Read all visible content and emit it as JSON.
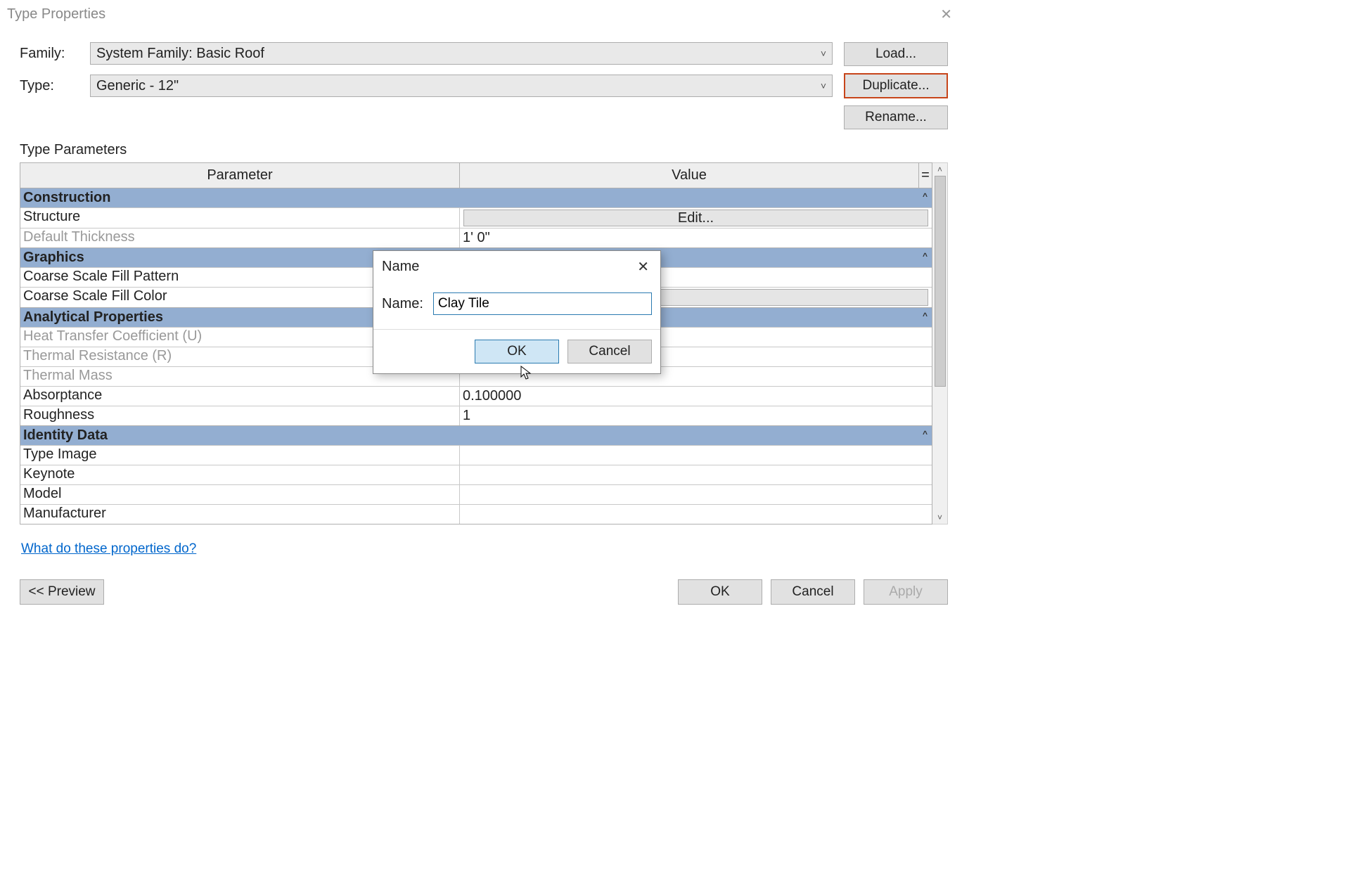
{
  "window": {
    "title": "Type Properties"
  },
  "labels": {
    "family": "Family:",
    "type": "Type:",
    "typeParams": "Type Parameters",
    "paramCol": "Parameter",
    "valueCol": "Value",
    "eqCol": "=",
    "helpLink": "What do these properties do?"
  },
  "selectors": {
    "family": "System Family: Basic Roof",
    "type": "Generic - 12\""
  },
  "buttons": {
    "load": "Load...",
    "duplicate": "Duplicate...",
    "rename": "Rename...",
    "preview": "<<  Preview",
    "ok": "OK",
    "cancel": "Cancel",
    "apply": "Apply",
    "edit": "Edit..."
  },
  "groups": [
    {
      "name": "Construction",
      "rows": [
        {
          "param": "Structure",
          "value_type": "edit"
        },
        {
          "param": "Default Thickness",
          "value": "1'  0\"",
          "dim": true
        }
      ]
    },
    {
      "name": "Graphics",
      "rows": [
        {
          "param": "Coarse Scale Fill Pattern",
          "value": ""
        },
        {
          "param": "Coarse Scale Fill Color",
          "value_type": "color"
        }
      ]
    },
    {
      "name": "Analytical Properties",
      "rows": [
        {
          "param": "Heat Transfer Coefficient (U)",
          "value": "",
          "dim": true
        },
        {
          "param": "Thermal Resistance (R)",
          "value": "",
          "dim": true
        },
        {
          "param": "Thermal Mass",
          "value": "",
          "dim": true
        },
        {
          "param": "Absorptance",
          "value": "0.100000"
        },
        {
          "param": "Roughness",
          "value": "1"
        }
      ]
    },
    {
      "name": "Identity Data",
      "rows": [
        {
          "param": "Type Image",
          "value": ""
        },
        {
          "param": "Keynote",
          "value": ""
        },
        {
          "param": "Model",
          "value": ""
        },
        {
          "param": "Manufacturer",
          "value": ""
        }
      ]
    }
  ],
  "modal": {
    "title": "Name",
    "label": "Name:",
    "value": "Clay Tile",
    "ok": "OK",
    "cancel": "Cancel"
  }
}
